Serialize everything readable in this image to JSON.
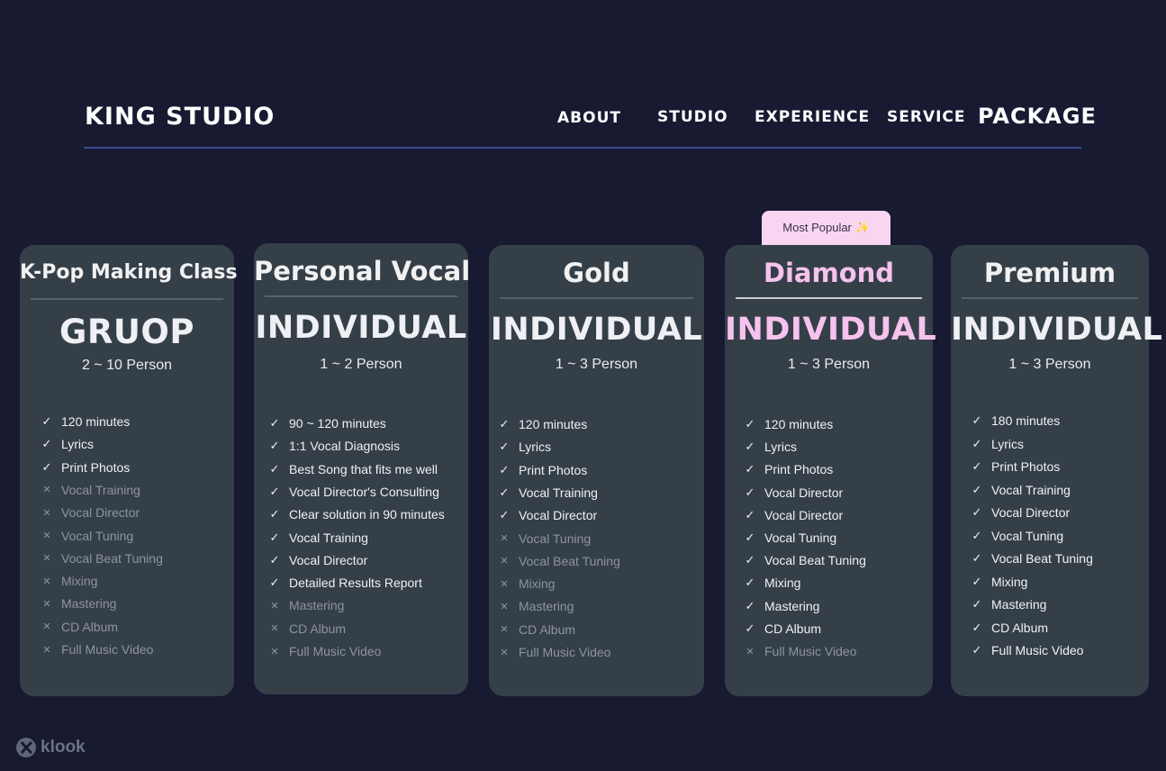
{
  "brand": "KING STUDIO",
  "nav": {
    "about": "ABOUT",
    "studio": "STUDIO",
    "experience": "EXPERIENCE",
    "service": "SERVICE",
    "package": "PACKAGE"
  },
  "badge": {
    "label": "Most Popular",
    "icon": "sparkle-icon"
  },
  "colors": {
    "background": "#171a31",
    "card": "#353f48",
    "accent_pink": "#f6c2ee",
    "nav_rule": "#3c4b8e"
  },
  "cards": [
    {
      "title": "K-Pop Making Class",
      "type": "GRUOP",
      "person": "2 ~ 10 Person",
      "features": [
        {
          "label": "120 minutes",
          "included": true
        },
        {
          "label": "Lyrics",
          "included": true
        },
        {
          "label": "Print Photos",
          "included": true
        },
        {
          "label": "Vocal Training",
          "included": false
        },
        {
          "label": "Vocal Director",
          "included": false
        },
        {
          "label": "Vocal Tuning",
          "included": false
        },
        {
          "label": "Vocal Beat Tuning",
          "included": false
        },
        {
          "label": "Mixing",
          "included": false
        },
        {
          "label": "Mastering",
          "included": false
        },
        {
          "label": "CD Album",
          "included": false
        },
        {
          "label": "Full Music Video",
          "included": false
        }
      ]
    },
    {
      "title": "Personal Vocal",
      "type": "INDIVIDUAL",
      "person": "1 ~ 2 Person",
      "features": [
        {
          "label": "90 ~ 120 minutes",
          "included": true
        },
        {
          "label": "1:1 Vocal Diagnosis",
          "included": true
        },
        {
          "label": "Best Song that fits me well",
          "included": true
        },
        {
          "label": "Vocal Director's Consulting",
          "included": true
        },
        {
          "label": "Clear solution in 90 minutes",
          "included": true
        },
        {
          "label": "Vocal Training",
          "included": true
        },
        {
          "label": "Vocal Director",
          "included": true
        },
        {
          "label": "Detailed Results Report",
          "included": true
        },
        {
          "label": "Mastering",
          "included": false
        },
        {
          "label": "CD Album",
          "included": false
        },
        {
          "label": "Full Music Video",
          "included": false
        }
      ]
    },
    {
      "title": "Gold",
      "type": "INDIVIDUAL",
      "person": "1 ~ 3 Person",
      "features": [
        {
          "label": "120 minutes",
          "included": true
        },
        {
          "label": "Lyrics",
          "included": true
        },
        {
          "label": "Print Photos",
          "included": true
        },
        {
          "label": "Vocal Training",
          "included": true
        },
        {
          "label": "Vocal Director",
          "included": true
        },
        {
          "label": "Vocal Tuning",
          "included": false
        },
        {
          "label": "Vocal Beat Tuning",
          "included": false
        },
        {
          "label": "Mixing",
          "included": false
        },
        {
          "label": "Mastering",
          "included": false
        },
        {
          "label": "CD Album",
          "included": false
        },
        {
          "label": "Full Music Video",
          "included": false
        }
      ]
    },
    {
      "title": "Diamond",
      "type": "INDIVIDUAL",
      "person": "1 ~ 3 Person",
      "features": [
        {
          "label": "120 minutes",
          "included": true
        },
        {
          "label": "Lyrics",
          "included": true
        },
        {
          "label": "Print Photos",
          "included": true
        },
        {
          "label": "Vocal Director",
          "included": true
        },
        {
          "label": "Vocal Director",
          "included": true
        },
        {
          "label": "Vocal Tuning",
          "included": true
        },
        {
          "label": "Vocal Beat Tuning",
          "included": true
        },
        {
          "label": "Mixing",
          "included": true
        },
        {
          "label": "Mastering",
          "included": true
        },
        {
          "label": "CD Album",
          "included": true
        },
        {
          "label": "Full Music Video",
          "included": false
        }
      ]
    },
    {
      "title": "Premium",
      "type": "INDIVIDUAL",
      "person": "1 ~ 3 Person",
      "features": [
        {
          "label": "180 minutes",
          "included": true
        },
        {
          "label": "Lyrics",
          "included": true
        },
        {
          "label": "Print Photos",
          "included": true
        },
        {
          "label": "Vocal Training",
          "included": true
        },
        {
          "label": "Vocal Director",
          "included": true
        },
        {
          "label": "Vocal Tuning",
          "included": true
        },
        {
          "label": "Vocal Beat Tuning",
          "included": true
        },
        {
          "label": "Mixing",
          "included": true
        },
        {
          "label": "Mastering",
          "included": true
        },
        {
          "label": "CD Album",
          "included": true
        },
        {
          "label": "Full Music Video",
          "included": true
        }
      ]
    }
  ],
  "watermark": "klook"
}
